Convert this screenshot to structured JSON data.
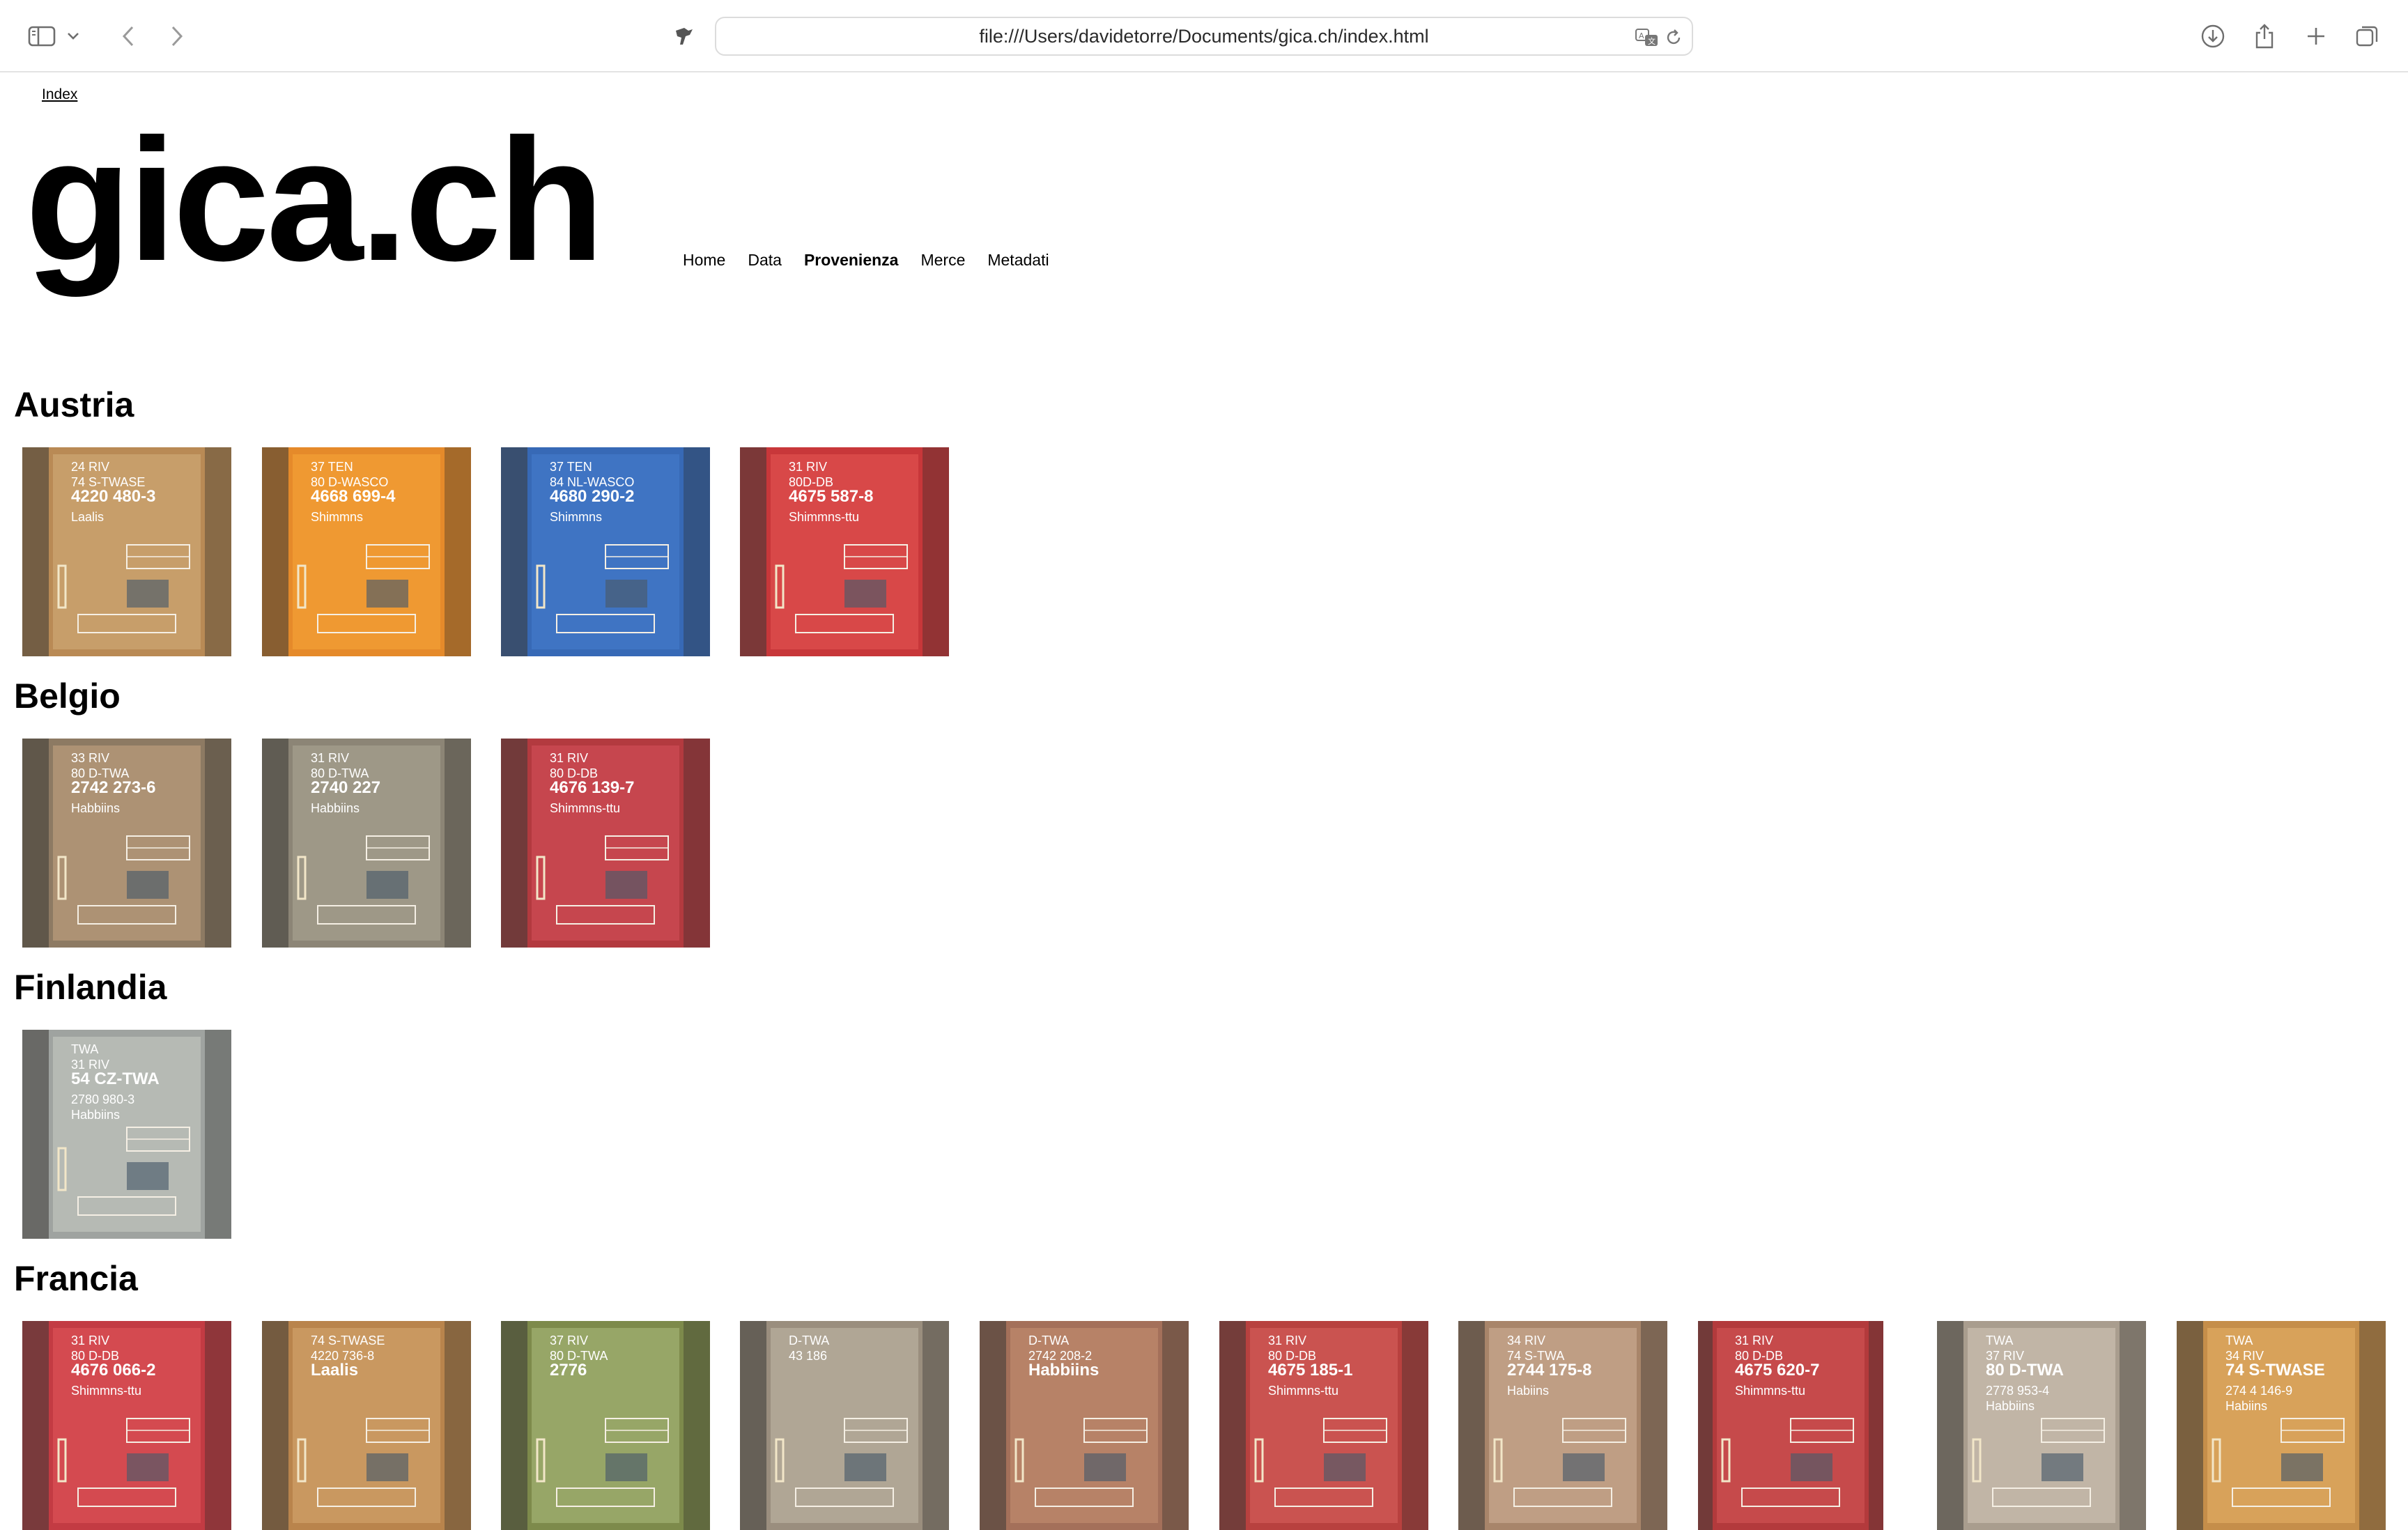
{
  "browser": {
    "url": "file:///Users/davidetorre/Documents/gica.ch/index.html",
    "icons": [
      "sidebar-icon",
      "chevron-down-icon",
      "back-icon",
      "forward-icon",
      "extension-icon",
      "translate-icon",
      "reload-icon",
      "download-icon",
      "share-icon",
      "new-tab-icon",
      "tab-overview-icon"
    ]
  },
  "page": {
    "index_link": "Index",
    "site_title": "gica.ch",
    "nav": [
      {
        "label": "Home",
        "active": false
      },
      {
        "label": "Data",
        "active": false
      },
      {
        "label": "Provenienza",
        "active": true
      },
      {
        "label": "Merce",
        "active": false
      },
      {
        "label": "Metadati",
        "active": false
      }
    ]
  },
  "sections": [
    {
      "title": "Austria",
      "count": 4
    },
    {
      "title": "Belgio",
      "count": 3
    },
    {
      "title": "Finlandia",
      "count": 1
    },
    {
      "title": "Francia",
      "count": 10
    }
  ],
  "thumbnails": [
    {
      "section": "Austria",
      "color": "#b98a55",
      "panel": "#c9a06d",
      "lines": [
        "24 RIV",
        "74 S-TWASE",
        "4220 480-3",
        "Laalis"
      ]
    },
    {
      "section": "Austria",
      "color": "#e58a2a",
      "panel": "#f09a33",
      "lines": [
        "37 TEN",
        "80 D-WASCO",
        "4668 699-4",
        "Shimmns"
      ]
    },
    {
      "section": "Austria",
      "color": "#3769b6",
      "panel": "#4076c4",
      "lines": [
        "37 TEN",
        "84 NL-WASCO",
        "4680 290-2",
        "Shimmns"
      ]
    },
    {
      "section": "Austria",
      "color": "#c8373a",
      "panel": "#d94a4a",
      "lines": [
        "31 RIV",
        "80D-DB",
        "4675 587-8",
        "Shimmns-ttu"
      ]
    },
    {
      "section": "Belgio",
      "color": "#8d7a63",
      "panel": "#b09575",
      "lines": [
        "33 RIV",
        "80 D-TWA",
        "2742 273-6",
        "Habbiins"
      ]
    },
    {
      "section": "Belgio",
      "color": "#8c8576",
      "panel": "#a09a8a",
      "lines": [
        "31 RIV",
        "80 D-TWA",
        "2740 227",
        "Habbiins"
      ]
    },
    {
      "section": "Belgio",
      "color": "#b33a3f",
      "panel": "#c84850",
      "lines": [
        "31 RIV",
        "80 D-DB",
        "4676 139-7",
        "Shimmns-ttu"
      ]
    },
    {
      "section": "Finlandia",
      "color": "#9fa3a0",
      "panel": "#b8bcb6",
      "lines": [
        "TWA",
        "31 RIV",
        "54 CZ-TWA",
        "2780 980-3",
        "Habbiins"
      ]
    },
    {
      "section": "Francia",
      "color": "#c33b43",
      "panel": "#d64d52",
      "lines": [
        "31 RIV",
        "80 D-DB",
        "4676 066-2",
        "Shimmns-ttu"
      ]
    },
    {
      "section": "Francia",
      "color": "#b9844c",
      "panel": "#cb9a63",
      "lines": [
        "74 S-TWASE",
        "4220 736-8",
        "Laalis"
      ]
    },
    {
      "section": "Francia",
      "color": "#7d8a4b",
      "panel": "#9aa86a",
      "lines": [
        "37 RIV",
        "80 D-TWA",
        "2776"
      ]
    },
    {
      "section": "Francia",
      "color": "#9a8e7e",
      "panel": "#b3a898",
      "lines": [
        "D-TWA",
        "43 186"
      ]
    },
    {
      "section": "Francia",
      "color": "#a4705a",
      "panel": "#b98468",
      "lines": [
        "D-TWA",
        "2742 208-2",
        "Habbiins"
      ]
    },
    {
      "section": "Francia",
      "color": "#b8413f",
      "panel": "#cc5552",
      "lines": [
        "31 RIV",
        "80 D-DB",
        "4675 185-1",
        "Shimmns-ttu"
      ]
    },
    {
      "section": "Francia",
      "color": "#a8856a",
      "panel": "#c1a187",
      "lines": [
        "34 RIV",
        "74 S-TWA",
        "2744 175-8",
        "Habiins"
      ]
    },
    {
      "section": "Francia",
      "color": "#b33a3c",
      "panel": "#c84c4c",
      "lines": [
        "31 RIV",
        "80 D-DB",
        "4675 620-7",
        "Shimmns-ttu"
      ]
    },
    {
      "section": "Francia",
      "color": "#a99d8e",
      "panel": "#c3b8a8",
      "lines": [
        "TWA",
        "37 RIV",
        "80 D-TWA",
        "2778 953-4",
        "Habbiins"
      ]
    },
    {
      "section": "Francia",
      "color": "#c58e4a",
      "panel": "#d9a45c",
      "lines": [
        "TWA",
        "34 RIV",
        "74 S-TWASE",
        "274 4 146-9",
        "Habiins"
      ]
    }
  ]
}
